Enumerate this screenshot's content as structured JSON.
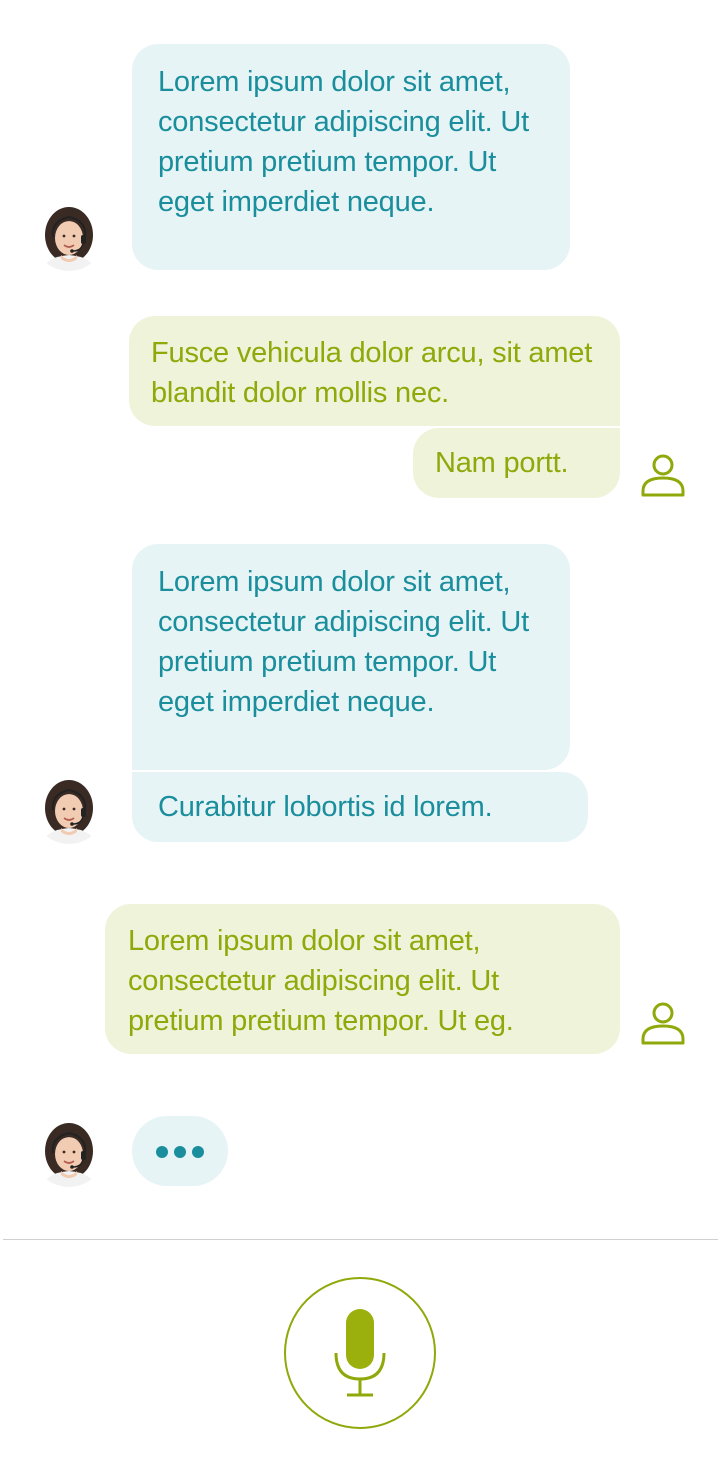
{
  "messages": [
    {
      "sender": "agent",
      "text": "Lorem ipsum dolor sit amet, consectetur adipiscing elit. Ut pretium pretium tempor. Ut eget imperdiet neque."
    },
    {
      "sender": "user",
      "text": "Fusce vehicula dolor arcu, sit amet blandit dolor mollis nec."
    },
    {
      "sender": "user",
      "text": "Nam portt."
    },
    {
      "sender": "agent",
      "text": "Lorem ipsum dolor sit amet, consectetur adipiscing elit. Ut pretium pretium tempor. Ut eget imperdiet neque."
    },
    {
      "sender": "agent",
      "text": "Curabitur lobortis id lorem."
    },
    {
      "sender": "user",
      "text": "Lorem ipsum dolor sit amet, consectetur adipiscing elit. Ut pretium pretium tempor. Ut eg."
    }
  ],
  "icons": {
    "agent_avatar": "agent-avatar",
    "user": "user-icon",
    "typing": "typing-indicator-icon",
    "mic": "microphone-icon"
  },
  "colors": {
    "agent_bubble": "#e6f4f6",
    "agent_text": "#1a8e9c",
    "user_bubble": "#eff3da",
    "user_text": "#8fa80a",
    "divider": "#d0d0d0"
  }
}
